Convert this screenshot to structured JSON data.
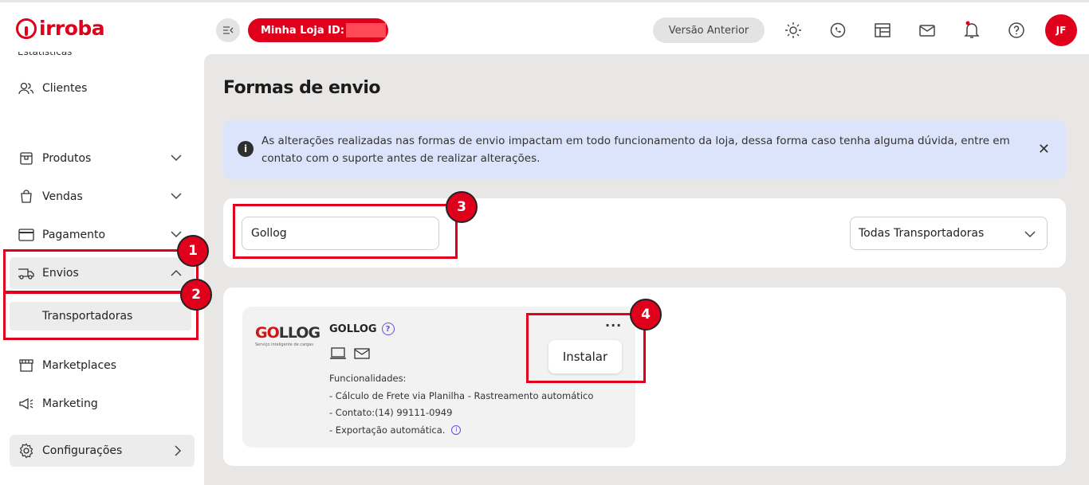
{
  "brand": {
    "name": "irroba",
    "color": "#e0001b"
  },
  "header": {
    "store_label": "Minha Loja ID:",
    "version_button": "Versão Anterior",
    "avatar_initials": "JF",
    "icons": [
      "sun-icon",
      "whatsapp-icon",
      "calendar-icon",
      "mail-icon",
      "bell-icon",
      "help-icon"
    ]
  },
  "sidebar": {
    "cut_item": "Estatísticas",
    "items": [
      {
        "label": "Clientes",
        "icon": "users-icon"
      },
      {
        "label": "Produtos",
        "icon": "box-icon"
      },
      {
        "label": "Vendas",
        "icon": "bag-icon"
      },
      {
        "label": "Pagamento",
        "icon": "card-icon"
      },
      {
        "label": "Envios",
        "icon": "truck-icon"
      },
      {
        "label": "Marketplaces",
        "icon": "store-icon"
      },
      {
        "label": "Marketing",
        "icon": "megaphone-icon"
      },
      {
        "label": "Configurações",
        "icon": "gear-icon"
      }
    ],
    "sub_item": "Transportadoras"
  },
  "main": {
    "title": "Formas de envio",
    "alert": "As alterações realizadas nas formas de envio impactam em todo funcionamento da loja, dessa forma caso tenha alguma dúvida, entre em contato com o suporte antes de realizar alterações.",
    "search_value": "Gollog",
    "filter_selected": "Todas Transportadoras",
    "carrier": {
      "logo_go": "GO",
      "logo_log": "LLOG",
      "logo_tagline": "Serviço inteligente de cargas",
      "name": "GOLLOG",
      "features_title": "Funcionalidades:",
      "features": [
        "- Cálculo de Frete via Planilha - Rastreamento automático",
        "- Contato:(14) 99111-0949",
        "- Exportação automática."
      ],
      "more": "···",
      "install_label": "Instalar"
    }
  },
  "annotations": [
    "1",
    "2",
    "3",
    "4"
  ]
}
